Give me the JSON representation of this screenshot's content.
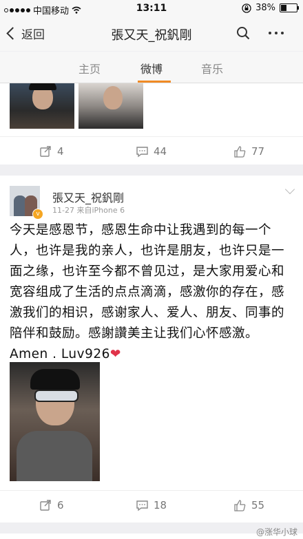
{
  "status": {
    "carrier": "中国移动",
    "time": "13:11",
    "battery_text": "38%",
    "battery_level": 0.38
  },
  "nav": {
    "back_label": "返回",
    "title": "張又天_祝釩剛"
  },
  "tabs": [
    {
      "label": "主页"
    },
    {
      "label": "微博"
    },
    {
      "label": "音乐"
    }
  ],
  "post1": {
    "reposts": "4",
    "comments": "44",
    "likes": "77"
  },
  "post2": {
    "username": "張又天_祝釩剛",
    "meta": "11-27  来自iPhone 6",
    "text": "今天是感恩节，感恩生命中让我遇到的每一个人，也许是我的亲人，也许是朋友，也许只是一面之缘，也许至今都不曾见过，是大家用爱心和宽容组成了生活的点点滴滴，感激你的存在，感激我们的相识，感谢家人、爱人、朋友、同事的陪伴和鼓励。感謝讚美主让我们心怀感激。 Amen . Luv926",
    "heart": "❤",
    "reposts": "6",
    "comments": "18",
    "likes": "55"
  },
  "watermark": "@涨华小球",
  "colors": {
    "accent": "#f08a24",
    "verified_badge": "#f5a623",
    "heart": "#e0334a"
  }
}
